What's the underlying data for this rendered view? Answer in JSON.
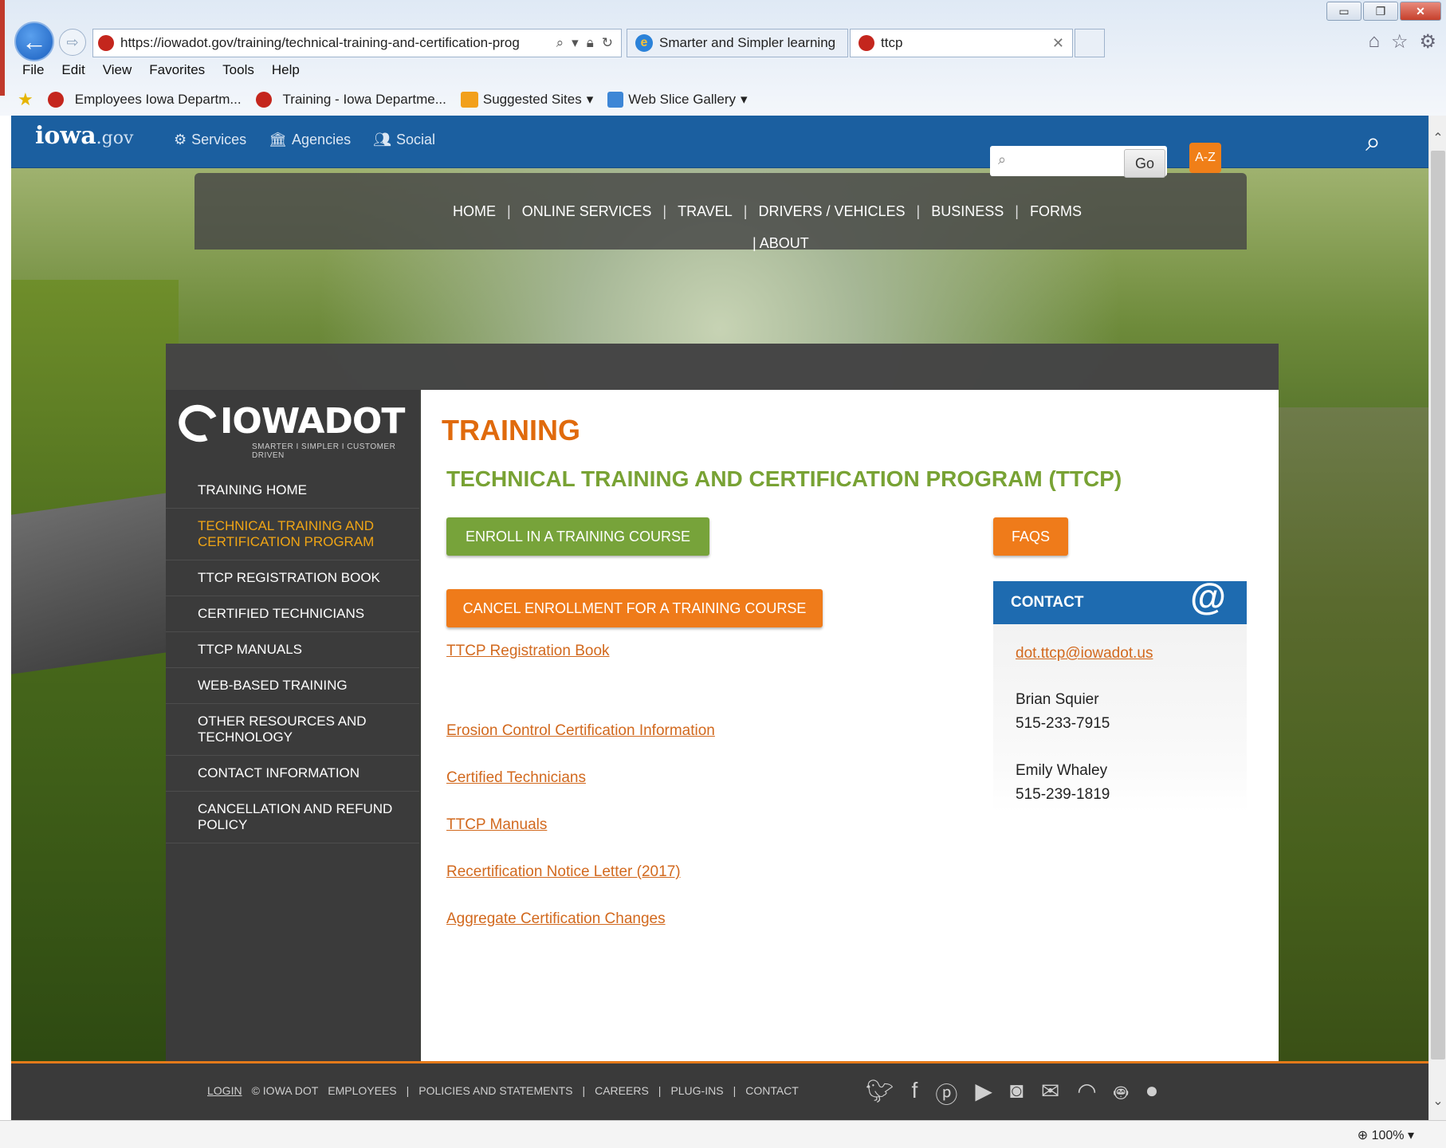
{
  "browser": {
    "url": "https://iowadot.gov/training/technical-training-and-certification-prog",
    "tabs": [
      {
        "label": "Smarter and Simpler learning"
      },
      {
        "label": "ttcp"
      }
    ],
    "menu": [
      "File",
      "Edit",
      "View",
      "Favorites",
      "Tools",
      "Help"
    ],
    "favorites": [
      "Employees Iowa Departm...",
      "Training - Iowa Departme...",
      "Suggested Sites",
      "Web Slice Gallery"
    ],
    "zoom": "100%"
  },
  "iowagov": {
    "logo": "iowa",
    "logo_suffix": ".gov",
    "nav": [
      "Services",
      "Agencies",
      "Social"
    ]
  },
  "mainnav": {
    "links": [
      "HOME",
      "ONLINE SERVICES",
      "TRAVEL",
      "DRIVERS / VEHICLES",
      "BUSINESS",
      "FORMS"
    ],
    "about": "ABOUT",
    "go": "Go",
    "az": "A-Z"
  },
  "logo": {
    "name": "IOWADOT",
    "tagline": "SMARTER I SIMPLER I CUSTOMER DRIVEN"
  },
  "sidebar": {
    "items": [
      "TRAINING HOME",
      "TECHNICAL TRAINING AND CERTIFICATION PROGRAM",
      "TTCP REGISTRATION BOOK",
      "CERTIFIED TECHNICIANS",
      "TTCP MANUALS",
      "WEB-BASED TRAINING",
      "OTHER RESOURCES AND TECHNOLOGY",
      "CONTACT INFORMATION",
      "CANCELLATION AND REFUND POLICY"
    ]
  },
  "main": {
    "title": "TRAINING",
    "subtitle": "TECHNICAL TRAINING AND CERTIFICATION PROGRAM (TTCP)",
    "enroll": "ENROLL IN A TRAINING COURSE",
    "cancel": "CANCEL ENROLLMENT FOR A TRAINING COURSE",
    "faqs": "FAQS",
    "links": [
      "TTCP Registration Book",
      "Erosion Control Certification Information",
      "Certified Technicians",
      "TTCP Manuals",
      "Recertification Notice Letter (2017)",
      "Aggregate Certification Changes"
    ]
  },
  "contact": {
    "title": "CONTACT",
    "email": "dot.ttcp@iowadot.us",
    "person1": "Brian Squier",
    "phone1": "515-233-7915",
    "person2": "Emily Whaley",
    "phone2": "515-239-1819"
  },
  "footer": {
    "login": "LOGIN",
    "copyright": "© IOWA DOT",
    "links": [
      "EMPLOYEES",
      "POLICIES AND STATEMENTS",
      "CAREERS",
      "PLUG-INS",
      "CONTACT"
    ]
  },
  "colors": {
    "accent_orange": "#e06a0c",
    "accent_green": "#78a234",
    "header_blue": "#1b5fa0"
  }
}
